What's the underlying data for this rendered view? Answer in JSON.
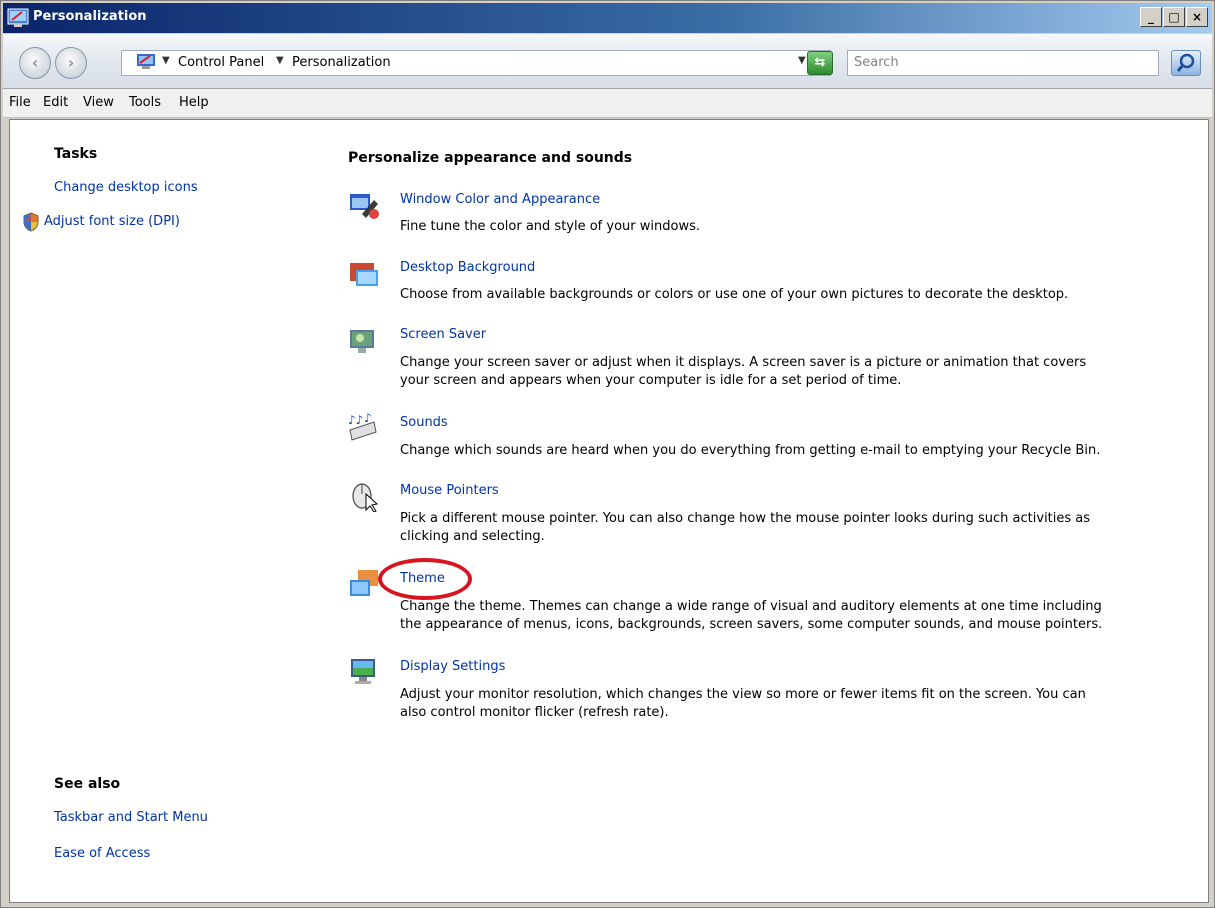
{
  "window": {
    "title": "Personalization",
    "controls": {
      "minimize": "_",
      "maximize": "□",
      "close": "×"
    }
  },
  "address_bar": {
    "breadcrumbs": [
      "Control Panel",
      "Personalization"
    ],
    "search_placeholder": "Search"
  },
  "menu": [
    "File",
    "Edit",
    "View",
    "Tools",
    "Help"
  ],
  "sidebar": {
    "tasks_heading": "Tasks",
    "tasks": [
      {
        "label": "Change desktop icons",
        "icon": ""
      },
      {
        "label": "Adjust font size (DPI)",
        "icon": "shield-icon"
      }
    ],
    "see_also_heading": "See also",
    "see_also": [
      "Taskbar and Start Menu",
      "Ease of Access"
    ]
  },
  "main": {
    "heading": "Personalize appearance and sounds",
    "items": [
      {
        "title": "Window Color and Appearance",
        "icon": "window-color-icon",
        "description": [
          "Fine tune the color and style of your windows."
        ]
      },
      {
        "title": "Desktop Background",
        "icon": "desktop-background-icon",
        "description": [
          "Choose from available backgrounds or colors or use one of your own pictures to decorate the desktop."
        ]
      },
      {
        "title": "Screen Saver",
        "icon": "screen-saver-icon",
        "description": [
          "Change your screen saver or adjust when it displays. A screen saver is a picture or animation that covers",
          "your screen and appears when your computer is idle for a set period of time."
        ]
      },
      {
        "title": "Sounds",
        "icon": "sounds-icon",
        "description": [
          "Change which sounds are heard when you do everything from getting e-mail to emptying your Recycle Bin."
        ]
      },
      {
        "title": "Mouse Pointers",
        "icon": "mouse-pointer-icon",
        "description": [
          "Pick a different mouse pointer. You can also change how the mouse pointer looks during such activities as",
          "clicking and selecting."
        ]
      },
      {
        "title": "Theme",
        "icon": "theme-icon",
        "description": [
          "Change the theme. Themes can change a wide range of visual and auditory elements at one time including",
          "the appearance of menus, icons, backgrounds, screen savers, some computer sounds, and mouse pointers."
        ]
      },
      {
        "title": "Display Settings",
        "icon": "display-settings-icon",
        "description": [
          "Adjust your monitor resolution, which changes the view so more or fewer items fit on the screen. You can",
          "also control monitor flicker (refresh rate)."
        ]
      }
    ]
  },
  "annotation": {
    "highlight_color": "#d8141e",
    "highlighted_item": "Theme"
  },
  "colors": {
    "link": "#0033aa",
    "title_bar": "#0a246a"
  }
}
